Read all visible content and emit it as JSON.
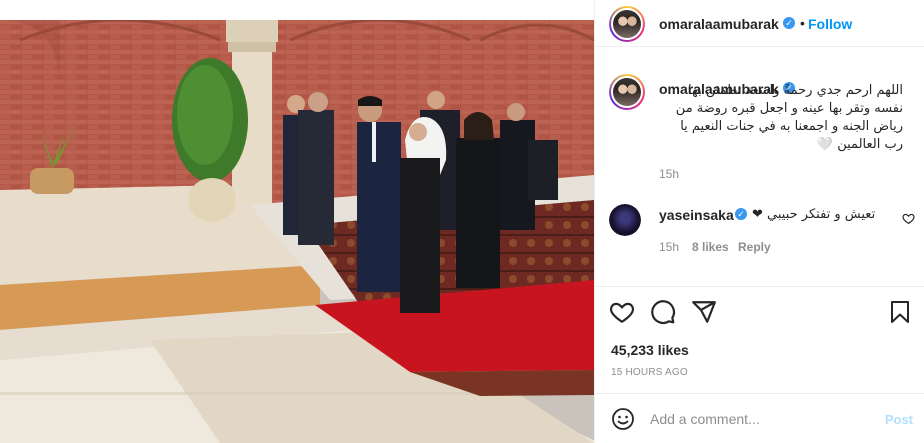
{
  "post": {
    "author": "omaralaamubarak",
    "follow_label": "Follow",
    "dot": "•",
    "caption": "اللهم ارحم جدي رحمةً واسعة تطمئن بها نفسه وتقر بها عينه و اجعل قبره روضة من رياض الجنه و اجمعنا به في جنات النعيم يا رب العالمين 🤍",
    "caption_time": "15h",
    "likes": "45,233 likes",
    "time_ago": "15 HOURS AGO"
  },
  "comments": [
    {
      "user": "yaseinsaka",
      "text": "تعيش و تفتكر حبيبي ❤",
      "time": "15h",
      "likes": "8 likes",
      "reply_label": "Reply"
    }
  ],
  "add_comment": {
    "placeholder": "Add a comment...",
    "post_label": "Post"
  },
  "icons": {
    "verified": "verified-badge-icon",
    "like": "heart-icon",
    "comment": "comment-icon",
    "share": "share-icon",
    "save": "bookmark-icon",
    "emoji": "emoji-icon"
  },
  "colors": {
    "accent": "#0095f6",
    "verified": "#3897f0",
    "muted": "#8e8e8e",
    "carpet_red": "#c8141e",
    "brick": "#b65a4a"
  }
}
